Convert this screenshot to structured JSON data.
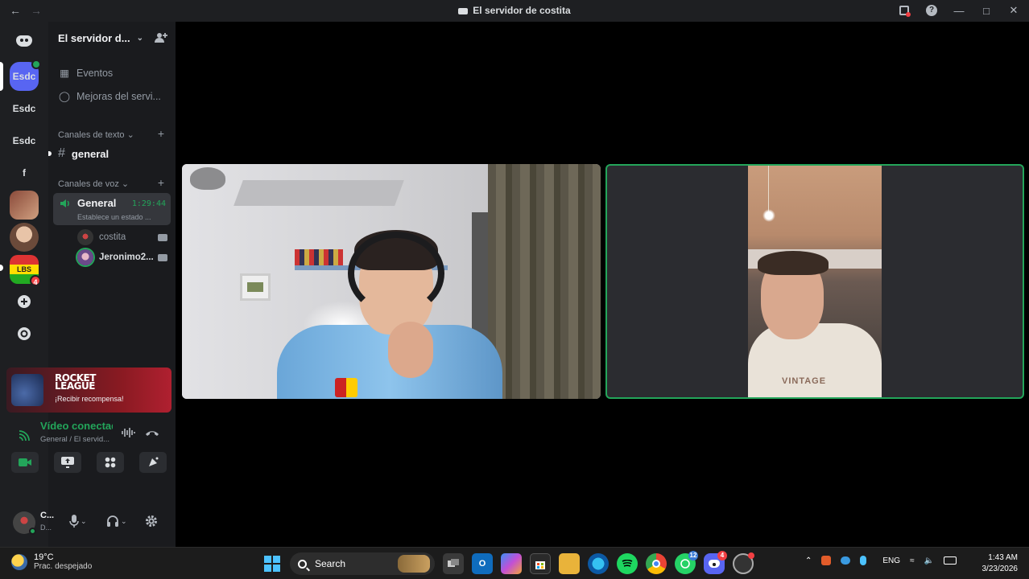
{
  "window": {
    "title": "El servidor de costita"
  },
  "rail": {
    "servers": [
      {
        "label": "Esdc"
      },
      {
        "label": "Esdc"
      },
      {
        "label": "Esdc"
      },
      {
        "label": "f"
      },
      {
        "label": ""
      },
      {
        "label": ""
      },
      {
        "label": "LBS",
        "badge": "4"
      }
    ]
  },
  "sidebar": {
    "server_name": "El servidor d...",
    "items": [
      {
        "label": "Eventos"
      },
      {
        "label": "Mejoras del servi..."
      }
    ],
    "text_category": "Canales de texto",
    "text_channel": "general",
    "voice_category": "Canales de voz",
    "voice_channel": {
      "name": "General",
      "timer": "1:29:44",
      "status": "Establece un estado ..."
    },
    "voice_users": [
      {
        "name": "costita"
      },
      {
        "name": "Jeronimo2..."
      }
    ]
  },
  "promo": {
    "game_logo": "ROCKET LEAGUE",
    "reward": "¡Recibir recompensa!"
  },
  "voice_panel": {
    "title": "Vídeo conectado",
    "subtitle": "General / El servid..."
  },
  "user": {
    "name": "C...",
    "status": "D..."
  },
  "video": {
    "tile_b_shirt_text": "VINTAGE"
  },
  "taskbar": {
    "weather_temp": "19°C",
    "weather_cond": "Prac. despejado",
    "search_label": "Search",
    "whatsapp_badge": "12",
    "discord_badge": "4",
    "lang": "ENG",
    "time": "1:43 AM",
    "date": "3/23/2026"
  },
  "colors": {
    "accent": "#5865f2",
    "online": "#23a55a",
    "danger": "#f23f43"
  }
}
